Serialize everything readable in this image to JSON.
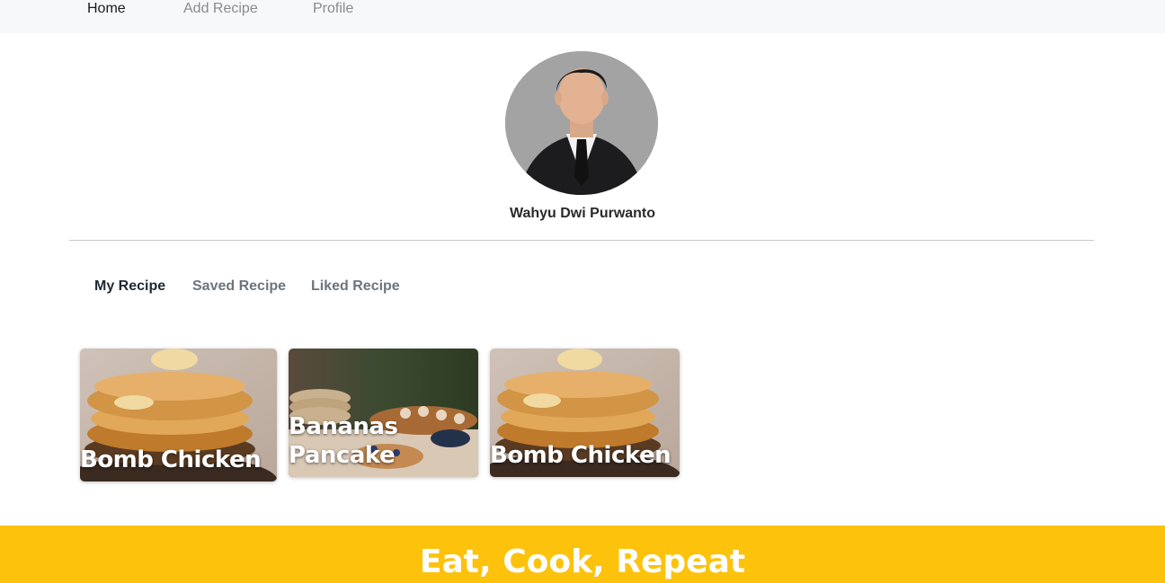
{
  "nav": {
    "items": [
      {
        "label": "Home",
        "active": true
      },
      {
        "label": "Add Recipe",
        "active": false
      },
      {
        "label": "Profile",
        "active": false
      }
    ]
  },
  "profile": {
    "name": "Wahyu Dwi Purwanto",
    "avatar_alt": "profile photo"
  },
  "tabs": [
    {
      "label": "My Recipe",
      "active": true
    },
    {
      "label": "Saved Recipe",
      "active": false
    },
    {
      "label": "Liked Recipe",
      "active": false
    }
  ],
  "recipes": [
    {
      "title": "Bomb Chicken",
      "image": "pancake-stack-photo"
    },
    {
      "title": "Bananas\nPancake",
      "image": "pancake-spread-photo"
    },
    {
      "title": "Bomb Chicken",
      "image": "pancake-stack-photo"
    }
  ],
  "footer": {
    "tagline": "Eat, Cook, Repeat"
  },
  "colors": {
    "footer_bg": "#fdc20c",
    "nav_bg": "#f7f8fa",
    "active_text": "#1f2933",
    "inactive_text": "#6c757d"
  }
}
